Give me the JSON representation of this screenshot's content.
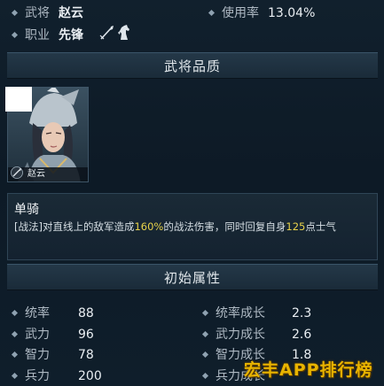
{
  "general_info": {
    "general_label": "武将",
    "general_value": "赵云",
    "usage_label": "使用率",
    "usage_value": "13.04%",
    "class_label": "职业",
    "class_value": "先锋",
    "class_icons": [
      "spear-icon",
      "horse-icon"
    ]
  },
  "quality_section": {
    "title": "武将品质"
  },
  "portrait": {
    "name": "赵云",
    "badge_icon": "spear-icon"
  },
  "skill": {
    "name": "单骑",
    "desc_part1": "[战法]对直线上的敌军造成",
    "desc_hl1": "160%",
    "desc_part2": "的战法伤害，同时回复自身",
    "desc_hl2": "125",
    "desc_part3": "点士气"
  },
  "attributes_section": {
    "title": "初始属性"
  },
  "base_stats": [
    {
      "label": "统率",
      "value": "88"
    },
    {
      "label": "武力",
      "value": "96"
    },
    {
      "label": "智力",
      "value": "78"
    },
    {
      "label": "兵力",
      "value": "200"
    }
  ],
  "growth_stats": [
    {
      "label": "统率成长",
      "value": "2.3"
    },
    {
      "label": "武力成长",
      "value": "2.6"
    },
    {
      "label": "智力成长",
      "value": "1.8"
    },
    {
      "label": "兵力成长",
      "value": ""
    }
  ],
  "watermark": "宏丰APP排行榜",
  "colors": {
    "background": "#0e1b27",
    "highlight": "#e8d24a",
    "section_header": "#243848",
    "watermark": "#e8b400"
  }
}
